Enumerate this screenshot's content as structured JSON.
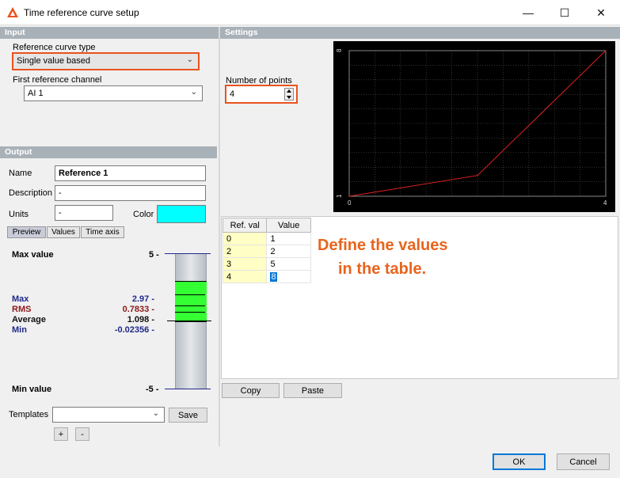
{
  "window": {
    "title": "Time reference curve setup",
    "minimize": "—",
    "maximize": "☐",
    "close": "✕"
  },
  "input": {
    "header": "Input",
    "curve_type_label": "Reference curve type",
    "curve_type_value": "Single value based",
    "first_channel_label": "First reference channel",
    "first_channel_value": "AI 1"
  },
  "settings": {
    "header": "Settings",
    "num_points_label": "Number of points",
    "num_points_value": "4"
  },
  "output": {
    "header": "Output",
    "name_label": "Name",
    "name_value": "Reference 1",
    "description_label": "Description",
    "description_value": "-",
    "units_label": "Units",
    "units_value": "-",
    "color_label": "Color",
    "color_value": "#00ffff",
    "tabs": [
      "Preview",
      "Values",
      "Time axis"
    ],
    "max_value_label": "Max value",
    "min_value_label": "Min value",
    "max_value": "5 -",
    "min_value": "-5 -",
    "stats": [
      {
        "label": "Max",
        "value": "2.97 -",
        "color": "#1f2a8a"
      },
      {
        "label": "RMS",
        "value": "0.7833 -",
        "color": "#8b1a1a"
      },
      {
        "label": "Average",
        "value": "1.098 -",
        "color": "#111111"
      },
      {
        "label": "Min",
        "value": "-0.02356 -",
        "color": "#1f2a8a"
      }
    ],
    "templates_label": "Templates",
    "templates_value": "",
    "save_label": "Save",
    "add_label": "+",
    "remove_label": "-"
  },
  "table": {
    "headers": [
      "Ref. val",
      "Value"
    ],
    "rows": [
      {
        "ref": "0",
        "value": "1"
      },
      {
        "ref": "2",
        "value": "2"
      },
      {
        "ref": "3",
        "value": "5"
      },
      {
        "ref": "4",
        "value": "8"
      }
    ],
    "copy_label": "Copy",
    "paste_label": "Paste"
  },
  "annotation": {
    "line1": "Define the values",
    "line2": "in the table."
  },
  "chart_data": {
    "type": "line",
    "x": [
      0,
      2,
      3,
      4
    ],
    "y": [
      1,
      2,
      5,
      8
    ],
    "xlim": [
      0,
      4
    ],
    "ylim": [
      1,
      8
    ],
    "x_tick_labels": [
      "0",
      "4"
    ],
    "y_tick_labels": [
      "1",
      "8"
    ],
    "line_color": "#e02020",
    "background": "#000000",
    "grid": true
  },
  "footer": {
    "ok_label": "OK",
    "cancel_label": "Cancel"
  },
  "colors": {
    "accent": "#e8531e",
    "bar_green": "#33ff33"
  }
}
